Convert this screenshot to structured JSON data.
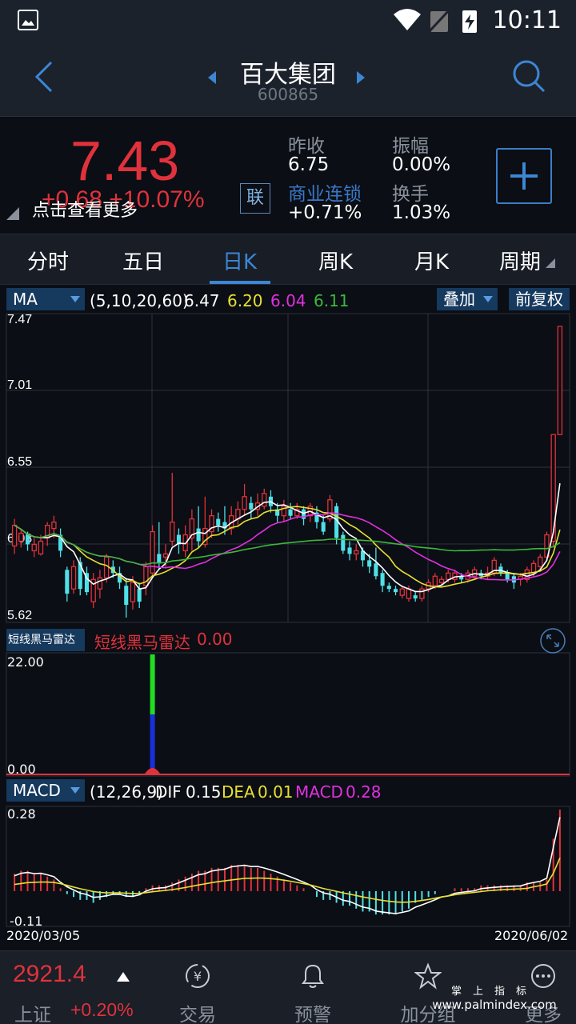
{
  "status_bar": {
    "time": "10:11"
  },
  "header": {
    "stock_name": "百大集团",
    "stock_code": "600865"
  },
  "quote": {
    "price": "7.43",
    "change": "+0.68 +10.07%",
    "hint": "点击查看更多",
    "link_button": "联",
    "prev_close_label": "昨收",
    "prev_close": "6.75",
    "amplitude_label": "振幅",
    "amplitude": "0.00%",
    "concept_label": "商业连锁",
    "concept_change": "+0.71%",
    "turnover_label": "换手",
    "turnover": "1.03%"
  },
  "tabs": [
    {
      "label": "分时",
      "active": false
    },
    {
      "label": "五日",
      "active": false
    },
    {
      "label": "日K",
      "active": true
    },
    {
      "label": "周K",
      "active": false
    },
    {
      "label": "月K",
      "active": false
    },
    {
      "label": "周期",
      "active": false
    }
  ],
  "ma_bar": {
    "indicator": "MA",
    "params": "(5,10,20,60)",
    "ma5": "6.47",
    "ma10": "6.20",
    "ma20": "6.04",
    "ma60": "6.11",
    "overlay": "叠加",
    "adjust": "前复权"
  },
  "price_axis": [
    "7.47",
    "7.01",
    "6.55",
    "6.08",
    "5.62"
  ],
  "radar": {
    "selector": "短线黑马雷达",
    "label": "短线黑马雷达",
    "value": "0.00",
    "axis_top": "22.00",
    "axis_bottom": "0.00"
  },
  "macd": {
    "selector": "MACD",
    "params": "(12,26,9)",
    "dif_label": "DIF",
    "dif": "0.15",
    "dea_label": "DEA",
    "dea": "0.01",
    "macd_label": "MACD",
    "macd": "0.28",
    "axis_top": "0.28",
    "axis_bottom": "-0.11"
  },
  "dates": {
    "start": "2020/03/05",
    "end": "2020/06/02"
  },
  "bottom_bar": {
    "index_value": "2921.4",
    "index_name": "上证",
    "index_change": "+0.20%",
    "nav": [
      "交易",
      "预警",
      "加分组",
      "更多"
    ]
  },
  "watermark": {
    "line1": "掌上指标",
    "line2": "www.palmindex.com"
  },
  "colors": {
    "up": "#e0323c",
    "down": "#4ee0e8",
    "ma5": "#ffffff",
    "ma10": "#e8e030",
    "ma20": "#e030e0",
    "ma60": "#3cb83c",
    "accent": "#3d86d4"
  },
  "chart_data": {
    "type": "candlestick",
    "x_start": "2020/03/05",
    "x_end": "2020/06/02",
    "ylim": [
      5.62,
      7.47
    ],
    "candles": [
      [
        6.05,
        6.18,
        6.22,
        6.0
      ],
      [
        6.08,
        6.13,
        6.16,
        6.04
      ],
      [
        6.12,
        6.06,
        6.14,
        6.02
      ],
      [
        6.02,
        6.06,
        6.1,
        5.98
      ],
      [
        6.0,
        6.08,
        6.12,
        5.99
      ],
      [
        6.1,
        6.18,
        6.2,
        6.05
      ],
      [
        6.16,
        6.2,
        6.24,
        6.1
      ],
      [
        6.12,
        6.02,
        6.16,
        5.98
      ],
      [
        5.9,
        5.75,
        5.92,
        5.7
      ],
      [
        5.78,
        5.92,
        5.96,
        5.75
      ],
      [
        5.95,
        5.78,
        5.98,
        5.74
      ],
      [
        5.88,
        5.76,
        5.92,
        5.74
      ],
      [
        5.7,
        5.84,
        5.88,
        5.66
      ],
      [
        5.78,
        5.85,
        5.9,
        5.72
      ],
      [
        5.85,
        5.98,
        6.0,
        5.82
      ],
      [
        5.92,
        5.88,
        5.96,
        5.85
      ],
      [
        5.88,
        5.82,
        5.92,
        5.78
      ],
      [
        5.8,
        5.68,
        5.85,
        5.6
      ],
      [
        5.7,
        5.82,
        5.86,
        5.65
      ],
      [
        5.78,
        5.7,
        5.82,
        5.66
      ],
      [
        5.8,
        5.92,
        5.95,
        5.74
      ],
      [
        5.88,
        6.14,
        6.18,
        5.86
      ],
      [
        6.0,
        5.94,
        6.2,
        5.9
      ],
      [
        5.98,
        6.0,
        6.06,
        5.92
      ],
      [
        6.08,
        6.2,
        6.51,
        6.05
      ],
      [
        6.12,
        6.06,
        6.16,
        6.0
      ],
      [
        6.02,
        6.12,
        6.18,
        5.98
      ],
      [
        6.1,
        6.22,
        6.28,
        6.02
      ],
      [
        6.16,
        6.08,
        6.3,
        6.04
      ],
      [
        6.06,
        6.16,
        6.36,
        6.04
      ],
      [
        6.14,
        6.24,
        6.28,
        6.1
      ],
      [
        6.22,
        6.18,
        6.26,
        6.14
      ],
      [
        6.2,
        6.16,
        6.3,
        6.12
      ],
      [
        6.16,
        6.24,
        6.3,
        6.12
      ],
      [
        6.22,
        6.28,
        6.33,
        6.18
      ],
      [
        6.28,
        6.36,
        6.44,
        6.24
      ],
      [
        6.32,
        6.28,
        6.36,
        6.22
      ],
      [
        6.28,
        6.32,
        6.38,
        6.24
      ],
      [
        6.3,
        6.38,
        6.41,
        6.28
      ],
      [
        6.36,
        6.3,
        6.4,
        6.26
      ],
      [
        6.28,
        6.24,
        6.32,
        6.2
      ],
      [
        6.24,
        6.3,
        6.34,
        6.2
      ],
      [
        6.28,
        6.24,
        6.32,
        6.22
      ],
      [
        6.24,
        6.28,
        6.32,
        6.22
      ],
      [
        6.28,
        6.22,
        6.3,
        6.18
      ],
      [
        6.24,
        6.3,
        6.32,
        6.2
      ],
      [
        6.26,
        6.2,
        6.3,
        6.16
      ],
      [
        6.2,
        6.14,
        6.24,
        6.12
      ],
      [
        6.22,
        6.34,
        6.37,
        6.2
      ],
      [
        6.3,
        6.1,
        6.32,
        6.06
      ],
      [
        6.12,
        6.02,
        6.14,
        6.0
      ],
      [
        6.04,
        6.0,
        6.08,
        5.96
      ],
      [
        6.0,
        6.02,
        6.06,
        5.96
      ],
      [
        6.02,
        5.96,
        6.04,
        5.92
      ],
      [
        5.96,
        5.92,
        6.0,
        5.88
      ],
      [
        5.94,
        5.86,
        6.04,
        5.84
      ],
      [
        5.88,
        5.8,
        5.9,
        5.76
      ],
      [
        5.8,
        5.78,
        5.82,
        5.76
      ],
      [
        5.78,
        5.76,
        5.8,
        5.74
      ],
      [
        5.74,
        5.78,
        5.8,
        5.72
      ],
      [
        5.72,
        5.78,
        5.8,
        5.7
      ],
      [
        5.74,
        5.72,
        5.76,
        5.7
      ],
      [
        5.72,
        5.78,
        5.8,
        5.7
      ],
      [
        5.78,
        5.82,
        5.84,
        5.76
      ],
      [
        5.8,
        5.86,
        5.88,
        5.78
      ],
      [
        5.82,
        5.84,
        5.86,
        5.8
      ],
      [
        5.84,
        5.88,
        5.9,
        5.82
      ],
      [
        5.84,
        5.88,
        5.9,
        5.82
      ],
      [
        5.86,
        5.84,
        5.88,
        5.82
      ],
      [
        5.84,
        5.88,
        5.9,
        5.82
      ],
      [
        5.86,
        5.9,
        5.92,
        5.84
      ],
      [
        5.88,
        5.86,
        5.9,
        5.84
      ],
      [
        5.86,
        5.88,
        5.92,
        5.84
      ],
      [
        5.88,
        5.96,
        5.98,
        5.86
      ],
      [
        5.92,
        5.88,
        5.94,
        5.86
      ],
      [
        5.88,
        5.84,
        5.9,
        5.82
      ],
      [
        5.86,
        5.82,
        5.88,
        5.78
      ],
      [
        5.84,
        5.86,
        5.88,
        5.8
      ],
      [
        5.84,
        5.9,
        5.92,
        5.82
      ],
      [
        5.88,
        5.94,
        5.96,
        5.86
      ],
      [
        5.92,
        5.98,
        6.0,
        5.9
      ],
      [
        5.98,
        6.12,
        6.14,
        5.96
      ],
      [
        6.08,
        6.75,
        6.75,
        6.04
      ],
      [
        6.75,
        7.43,
        7.43,
        6.75
      ]
    ],
    "radar": {
      "ylim": [
        0,
        22
      ],
      "spike_value": 22.0
    },
    "macd": {
      "ylim": [
        -0.11,
        0.28
      ],
      "hist": [
        0.06,
        0.07,
        0.07,
        0.06,
        0.06,
        0.05,
        0.04,
        0.01,
        -0.01,
        -0.02,
        -0.03,
        -0.03,
        -0.04,
        -0.03,
        -0.02,
        -0.01,
        -0.01,
        -0.02,
        -0.02,
        -0.01,
        0.01,
        0.02,
        0.02,
        0.02,
        0.03,
        0.04,
        0.05,
        0.06,
        0.07,
        0.07,
        0.08,
        0.08,
        0.08,
        0.09,
        0.09,
        0.09,
        0.08,
        0.08,
        0.07,
        0.06,
        0.05,
        0.04,
        0.03,
        0.02,
        0.01,
        0.0,
        -0.02,
        -0.03,
        -0.03,
        -0.04,
        -0.05,
        -0.05,
        -0.06,
        -0.07,
        -0.07,
        -0.08,
        -0.08,
        -0.08,
        -0.08,
        -0.07,
        -0.06,
        -0.04,
        -0.03,
        -0.02,
        -0.01,
        0.0,
        0.0,
        0.01,
        0.01,
        0.01,
        0.01,
        0.02,
        0.02,
        0.02,
        0.02,
        0.02,
        0.02,
        0.02,
        0.03,
        0.03,
        0.03,
        0.04,
        0.18,
        0.28
      ]
    }
  }
}
